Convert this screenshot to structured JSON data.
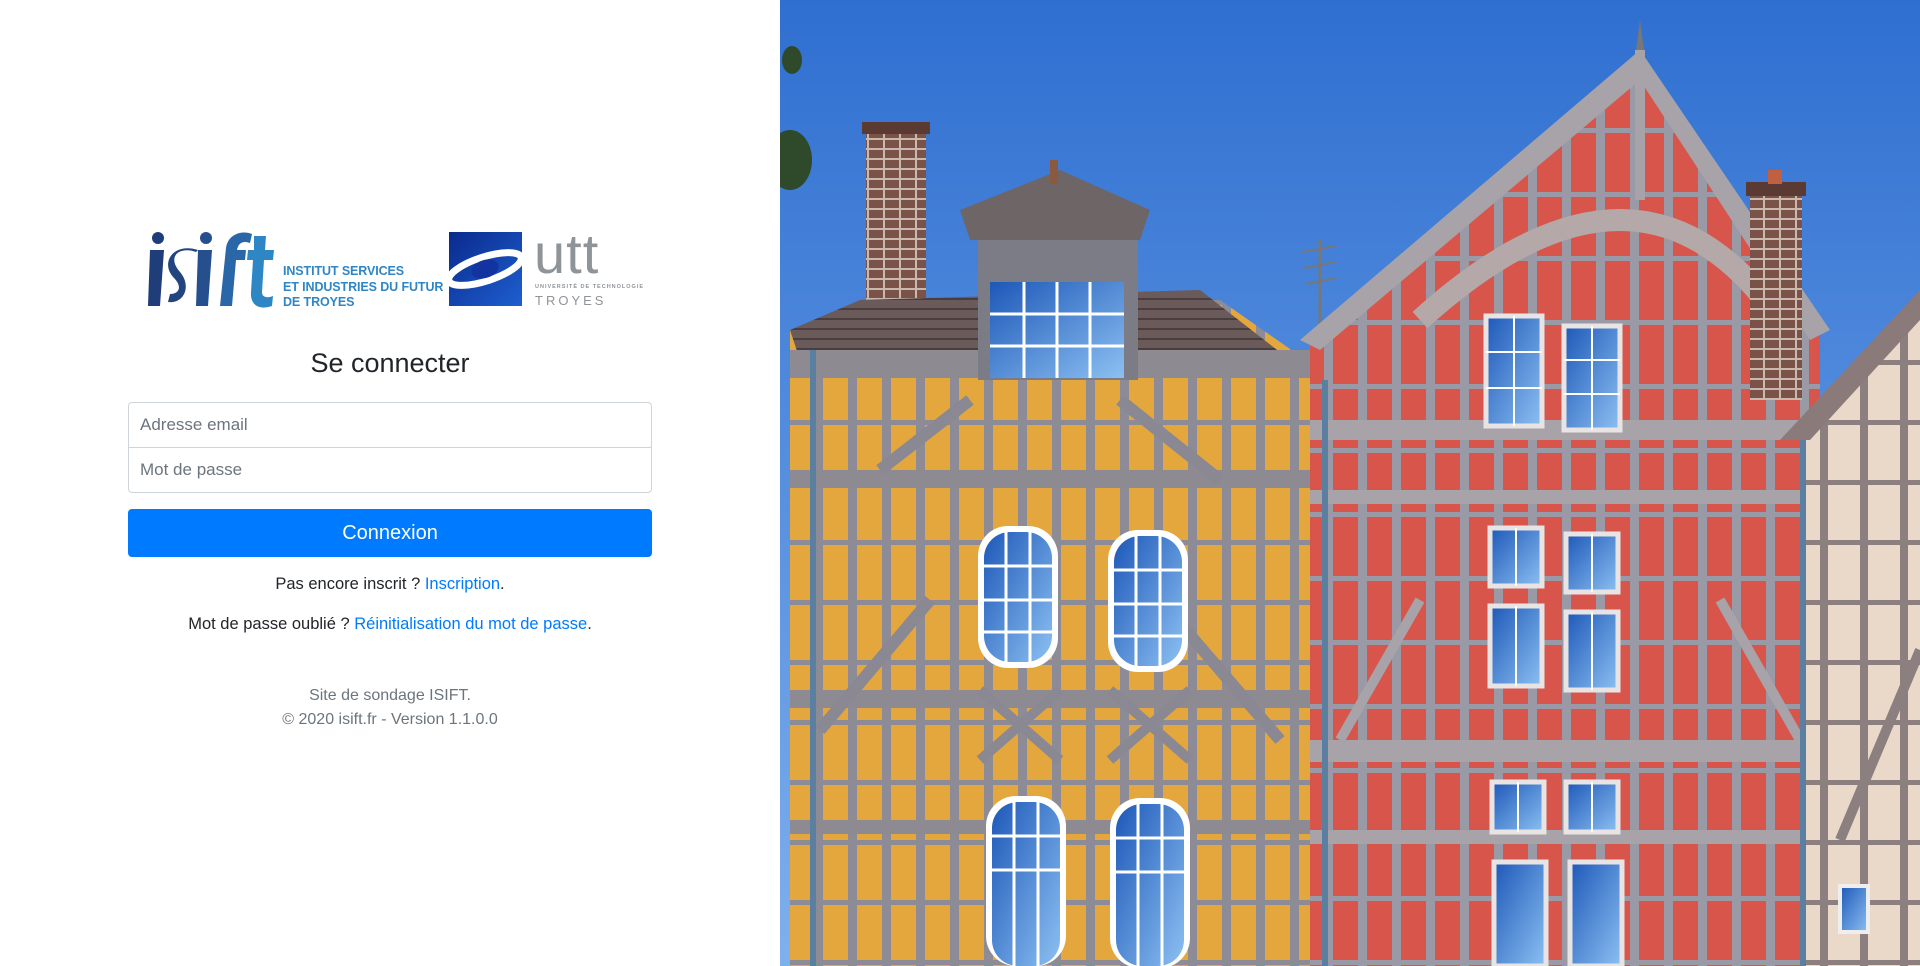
{
  "brand": {
    "isift_logo_text": "isift",
    "isift_caption_lines": [
      "INSTITUT SERVICES",
      "ET INDUSTRIES DU FUTUR",
      "DE TROYES"
    ],
    "utt_logo_text": "utt",
    "utt_subtitle": "UNIVERSITÉ DE TECHNOLOGIE",
    "utt_city": "TROYES"
  },
  "login": {
    "title": "Se connecter",
    "email_placeholder": "Adresse email",
    "password_placeholder": "Mot de passe",
    "submit_label": "Connexion",
    "register_prompt": "Pas encore inscrit ? ",
    "register_link": "Inscription",
    "register_suffix": ".",
    "reset_prompt": "Mot de passe oublié ? ",
    "reset_link": "Réinitialisation du mot de passe",
    "reset_suffix": "."
  },
  "footer": {
    "line1": "Site de sondage ISIFT.",
    "line2": "© 2020 isift.fr - Version 1.1.0.0"
  },
  "colors": {
    "primary": "#007bff",
    "isift_blue": "#2f86c5",
    "isift_dark": "#1f3d78",
    "utt_grey": "#8f9499",
    "sky": "#3f82d6",
    "timber_yellow": "#e0a33a",
    "timber_red": "#d9574e"
  },
  "background_image": {
    "icon": "half-timbered-houses-photo"
  }
}
